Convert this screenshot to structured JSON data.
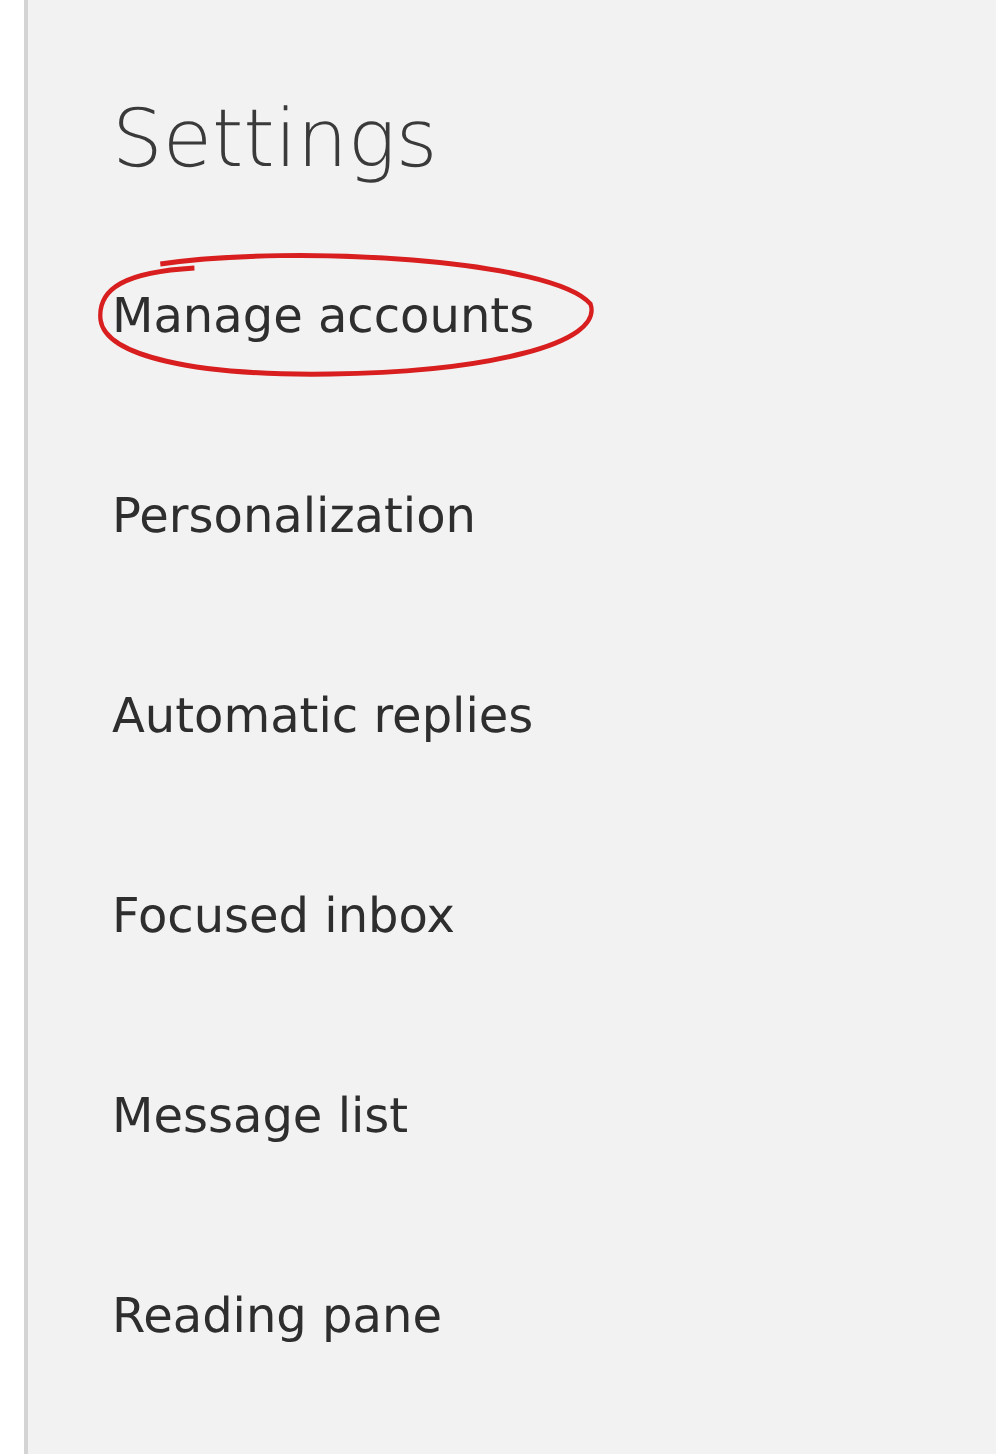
{
  "title": "Settings",
  "items": [
    {
      "label": "Manage accounts",
      "circled": true
    },
    {
      "label": "Personalization",
      "circled": false
    },
    {
      "label": "Automatic replies",
      "circled": false
    },
    {
      "label": "Focused inbox",
      "circled": false
    },
    {
      "label": "Message list",
      "circled": false
    },
    {
      "label": "Reading pane",
      "circled": false
    }
  ]
}
